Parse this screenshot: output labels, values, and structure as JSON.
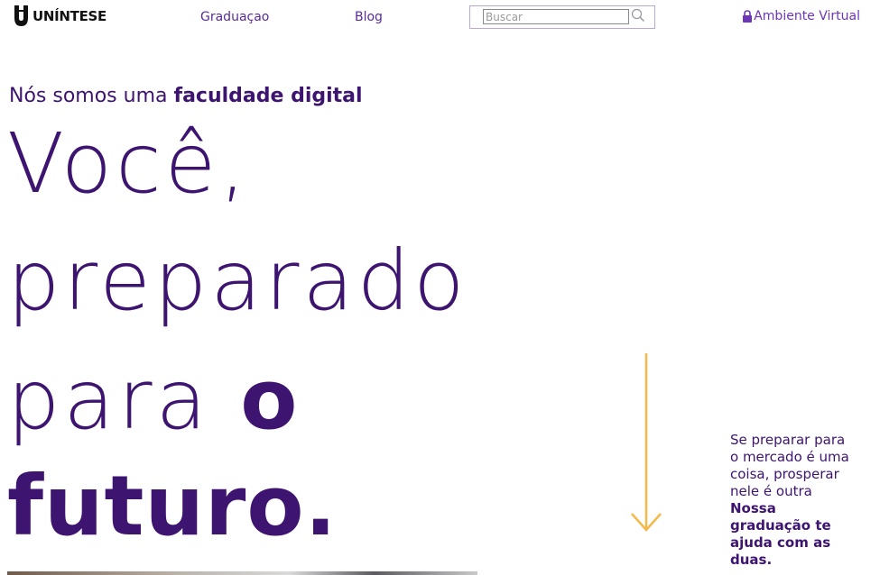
{
  "header": {
    "logo_text": "UNÍNTESE",
    "nav": [
      {
        "label": "Graduaçao"
      },
      {
        "label": "Blog"
      }
    ],
    "search": {
      "placeholder": "Buscar",
      "value": ""
    },
    "virtual_env_label": "Ambiente Virtual"
  },
  "hero": {
    "kicker_regular": "Nós somos uma ",
    "kicker_bold": "faculdade digital",
    "line1": "Você,",
    "line2": "preparado",
    "line3_regular": "para ",
    "line3_bold": "o",
    "line4": "futuro."
  },
  "aside": {
    "text_regular": "Se preparar para o mercado é uma coisa, prosperar nele é outra ",
    "text_bold": "Nossa graduação te ajuda com as duas."
  },
  "colors": {
    "brand_purple": "#3d1470",
    "link_purple": "#5b2a9a",
    "arrow_orange": "#f5b94a"
  }
}
